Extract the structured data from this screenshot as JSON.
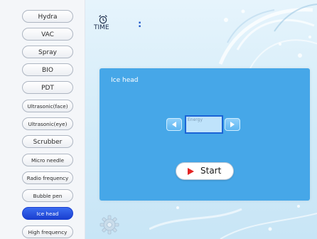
{
  "sidebar": {
    "items": [
      {
        "label": "Hydra",
        "active": false
      },
      {
        "label": "VAC",
        "active": false
      },
      {
        "label": "Spray",
        "active": false
      },
      {
        "label": "BIO",
        "active": false
      },
      {
        "label": "PDT",
        "active": false
      },
      {
        "label": "Ultrasonic(face)",
        "active": false
      },
      {
        "label": "Ultrasonic(eye)",
        "active": false
      },
      {
        "label": "Scrubber",
        "active": false
      },
      {
        "label": "Micro needle",
        "active": false
      },
      {
        "label": "Radio frequency",
        "active": false
      },
      {
        "label": "Bubble pen",
        "active": false
      },
      {
        "label": "Ice head",
        "active": true
      },
      {
        "label": "High frequency",
        "active": false
      }
    ]
  },
  "header": {
    "time_label": "TIME",
    "time_separator": ":"
  },
  "panel": {
    "title": "Ice head",
    "energy": {
      "label": "Energy",
      "value": ""
    },
    "start_label": "Start"
  },
  "icons": {
    "clock": "alarm-clock-icon",
    "decrease": "arrow-left-icon",
    "increase": "arrow-right-icon",
    "play": "play-icon",
    "settings": "gear-icon"
  },
  "colors": {
    "panel": "#46a7e8",
    "active_item": "#1a3fd0",
    "energy_border": "#1b64d6",
    "play": "#e32424",
    "time_separator": "#1d55c8"
  }
}
